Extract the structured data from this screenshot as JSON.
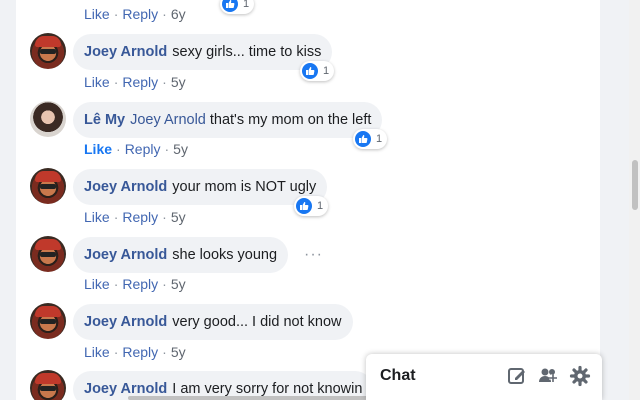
{
  "top_partial": {
    "like": "Like",
    "reply": "Reply",
    "time": "6y",
    "reaction_count": "1"
  },
  "comments": [
    {
      "author": "Joey Arnold",
      "mention": "",
      "text": "sexy girls... time to kiss",
      "like": "Like",
      "reply": "Reply",
      "time": "5y",
      "reaction_count": "1"
    },
    {
      "author": "Lê My",
      "mention": "Joey Arnold",
      "text": "that's my mom on the left",
      "like": "Like",
      "reply": "Reply",
      "time": "5y",
      "reaction_count": "1"
    },
    {
      "author": "Joey Arnold",
      "mention": "",
      "text": "your mom is NOT ugly",
      "like": "Like",
      "reply": "Reply",
      "time": "5y",
      "reaction_count": "1"
    },
    {
      "author": "Joey Arnold",
      "mention": "",
      "text": "she looks young",
      "like": "Like",
      "reply": "Reply",
      "time": "5y",
      "more": "···"
    },
    {
      "author": "Joey Arnold",
      "mention": "",
      "text": "very good... I did not know",
      "like": "Like",
      "reply": "Reply",
      "time": "5y"
    },
    {
      "author": "Joey Arnold",
      "mention": "",
      "text": "I am very sorry for not knowin"
    }
  ],
  "chat": {
    "title": "Chat"
  },
  "icons": {
    "like": "thumbs-up-icon",
    "compose": "compose-icon",
    "add_people": "add-people-icon",
    "settings": "gear-icon"
  },
  "colors": {
    "accent": "#1877f2",
    "author": "#385898",
    "bubble": "#f0f2f5"
  }
}
